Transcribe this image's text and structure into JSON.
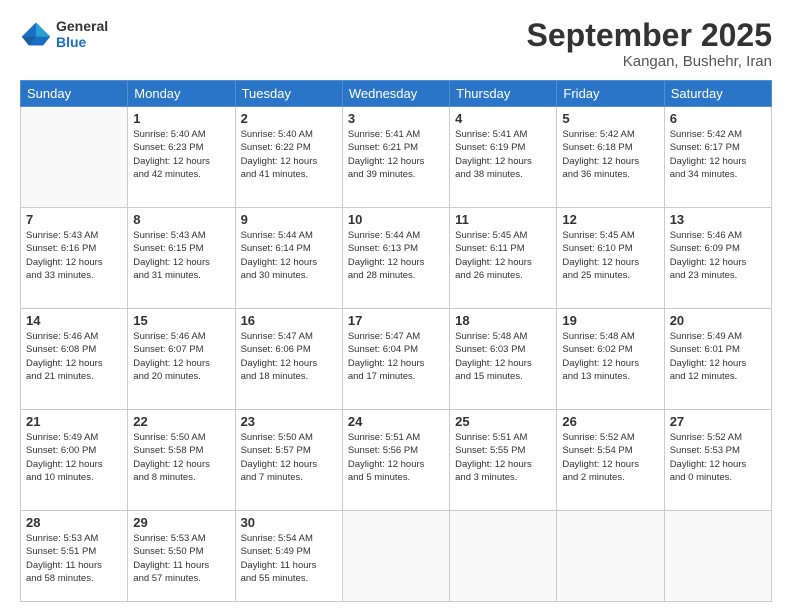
{
  "logo": {
    "line1": "General",
    "line2": "Blue"
  },
  "title": "September 2025",
  "subtitle": "Kangan, Bushehr, Iran",
  "header": {
    "days": [
      "Sunday",
      "Monday",
      "Tuesday",
      "Wednesday",
      "Thursday",
      "Friday",
      "Saturday"
    ]
  },
  "weeks": [
    [
      {
        "day": "",
        "info": ""
      },
      {
        "day": "1",
        "info": "Sunrise: 5:40 AM\nSunset: 6:23 PM\nDaylight: 12 hours\nand 42 minutes."
      },
      {
        "day": "2",
        "info": "Sunrise: 5:40 AM\nSunset: 6:22 PM\nDaylight: 12 hours\nand 41 minutes."
      },
      {
        "day": "3",
        "info": "Sunrise: 5:41 AM\nSunset: 6:21 PM\nDaylight: 12 hours\nand 39 minutes."
      },
      {
        "day": "4",
        "info": "Sunrise: 5:41 AM\nSunset: 6:19 PM\nDaylight: 12 hours\nand 38 minutes."
      },
      {
        "day": "5",
        "info": "Sunrise: 5:42 AM\nSunset: 6:18 PM\nDaylight: 12 hours\nand 36 minutes."
      },
      {
        "day": "6",
        "info": "Sunrise: 5:42 AM\nSunset: 6:17 PM\nDaylight: 12 hours\nand 34 minutes."
      }
    ],
    [
      {
        "day": "7",
        "info": "Sunrise: 5:43 AM\nSunset: 6:16 PM\nDaylight: 12 hours\nand 33 minutes."
      },
      {
        "day": "8",
        "info": "Sunrise: 5:43 AM\nSunset: 6:15 PM\nDaylight: 12 hours\nand 31 minutes."
      },
      {
        "day": "9",
        "info": "Sunrise: 5:44 AM\nSunset: 6:14 PM\nDaylight: 12 hours\nand 30 minutes."
      },
      {
        "day": "10",
        "info": "Sunrise: 5:44 AM\nSunset: 6:13 PM\nDaylight: 12 hours\nand 28 minutes."
      },
      {
        "day": "11",
        "info": "Sunrise: 5:45 AM\nSunset: 6:11 PM\nDaylight: 12 hours\nand 26 minutes."
      },
      {
        "day": "12",
        "info": "Sunrise: 5:45 AM\nSunset: 6:10 PM\nDaylight: 12 hours\nand 25 minutes."
      },
      {
        "day": "13",
        "info": "Sunrise: 5:46 AM\nSunset: 6:09 PM\nDaylight: 12 hours\nand 23 minutes."
      }
    ],
    [
      {
        "day": "14",
        "info": "Sunrise: 5:46 AM\nSunset: 6:08 PM\nDaylight: 12 hours\nand 21 minutes."
      },
      {
        "day": "15",
        "info": "Sunrise: 5:46 AM\nSunset: 6:07 PM\nDaylight: 12 hours\nand 20 minutes."
      },
      {
        "day": "16",
        "info": "Sunrise: 5:47 AM\nSunset: 6:06 PM\nDaylight: 12 hours\nand 18 minutes."
      },
      {
        "day": "17",
        "info": "Sunrise: 5:47 AM\nSunset: 6:04 PM\nDaylight: 12 hours\nand 17 minutes."
      },
      {
        "day": "18",
        "info": "Sunrise: 5:48 AM\nSunset: 6:03 PM\nDaylight: 12 hours\nand 15 minutes."
      },
      {
        "day": "19",
        "info": "Sunrise: 5:48 AM\nSunset: 6:02 PM\nDaylight: 12 hours\nand 13 minutes."
      },
      {
        "day": "20",
        "info": "Sunrise: 5:49 AM\nSunset: 6:01 PM\nDaylight: 12 hours\nand 12 minutes."
      }
    ],
    [
      {
        "day": "21",
        "info": "Sunrise: 5:49 AM\nSunset: 6:00 PM\nDaylight: 12 hours\nand 10 minutes."
      },
      {
        "day": "22",
        "info": "Sunrise: 5:50 AM\nSunset: 5:58 PM\nDaylight: 12 hours\nand 8 minutes."
      },
      {
        "day": "23",
        "info": "Sunrise: 5:50 AM\nSunset: 5:57 PM\nDaylight: 12 hours\nand 7 minutes."
      },
      {
        "day": "24",
        "info": "Sunrise: 5:51 AM\nSunset: 5:56 PM\nDaylight: 12 hours\nand 5 minutes."
      },
      {
        "day": "25",
        "info": "Sunrise: 5:51 AM\nSunset: 5:55 PM\nDaylight: 12 hours\nand 3 minutes."
      },
      {
        "day": "26",
        "info": "Sunrise: 5:52 AM\nSunset: 5:54 PM\nDaylight: 12 hours\nand 2 minutes."
      },
      {
        "day": "27",
        "info": "Sunrise: 5:52 AM\nSunset: 5:53 PM\nDaylight: 12 hours\nand 0 minutes."
      }
    ],
    [
      {
        "day": "28",
        "info": "Sunrise: 5:53 AM\nSunset: 5:51 PM\nDaylight: 11 hours\nand 58 minutes."
      },
      {
        "day": "29",
        "info": "Sunrise: 5:53 AM\nSunset: 5:50 PM\nDaylight: 11 hours\nand 57 minutes."
      },
      {
        "day": "30",
        "info": "Sunrise: 5:54 AM\nSunset: 5:49 PM\nDaylight: 11 hours\nand 55 minutes."
      },
      {
        "day": "",
        "info": ""
      },
      {
        "day": "",
        "info": ""
      },
      {
        "day": "",
        "info": ""
      },
      {
        "day": "",
        "info": ""
      }
    ]
  ]
}
